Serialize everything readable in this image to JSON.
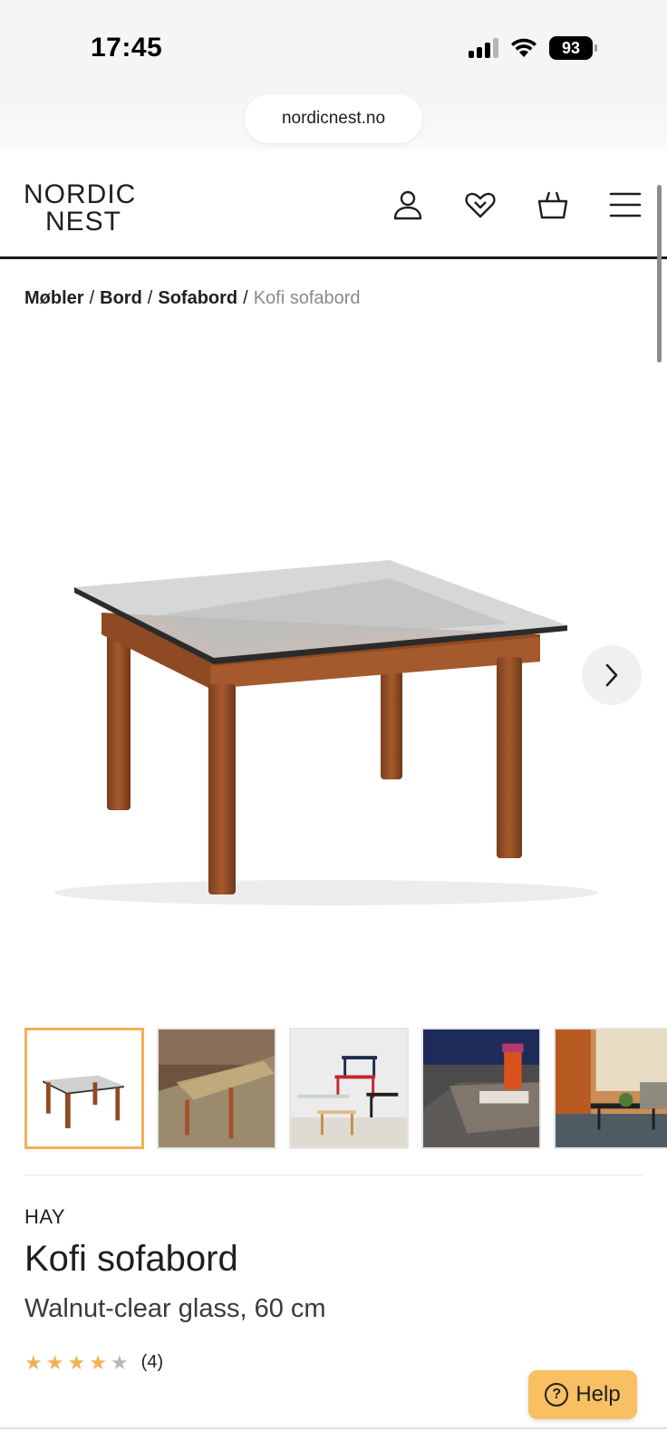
{
  "status_bar": {
    "time": "17:45",
    "battery": "93",
    "icons": [
      "signal-icon",
      "wifi-icon",
      "battery-icon"
    ]
  },
  "browser": {
    "url": "nordicnest.no"
  },
  "header": {
    "logo_line1": "NORDIC",
    "logo_line2": "NEST",
    "icons": [
      "account-icon",
      "wishlist-heart-icon",
      "basket-icon",
      "menu-icon"
    ]
  },
  "breadcrumb": {
    "items": [
      "Møbler",
      "Bord",
      "Sofabord"
    ],
    "current": "Kofi sofabord",
    "separator": "/"
  },
  "gallery": {
    "next_icon": "chevron-right-icon",
    "thumbnail_count": 5,
    "active_index": 0
  },
  "product": {
    "brand": "HAY",
    "title": "Kofi sofabord",
    "variant": "Walnut-clear glass, 60 cm",
    "rating": 4,
    "rating_max": 5,
    "rating_count": "(4)"
  },
  "help": {
    "label": "Help",
    "icon": "question-icon"
  },
  "colors": {
    "accent": "#f0b254",
    "help_bg": "#f8bf63",
    "text": "#1f1f1f",
    "muted": "#8a8a8a"
  }
}
